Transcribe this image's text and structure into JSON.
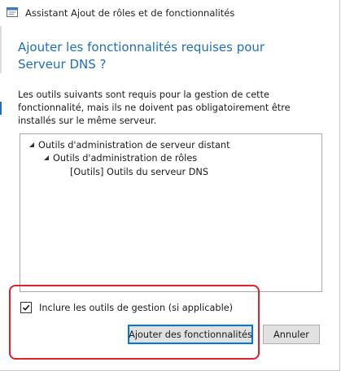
{
  "window": {
    "title": "Assistant Ajout de rôles et de fonctionnalités"
  },
  "dialog": {
    "heading": "Ajouter les fonctionnalités requises pour Serveur DNS ?",
    "description": "Les outils suivants sont requis pour la gestion de cette fonctionnalité, mais ils ne doivent pas obligatoirement être installés sur le même serveur."
  },
  "tree": {
    "items": [
      {
        "label": "Outils d'administration de serveur distant",
        "expanded": true
      },
      {
        "label": "Outils d'administration de rôles",
        "expanded": true
      },
      {
        "label": "[Outils] Outils du serveur DNS",
        "expanded": false
      }
    ]
  },
  "options": {
    "include_tools_label": "Inclure les outils de gestion (si applicable)",
    "include_tools_checked": true
  },
  "buttons": {
    "add_label": "Ajouter des fonctionnalités",
    "cancel_label": "Annuler"
  },
  "colors": {
    "heading": "#1c6fb8",
    "highlight": "#e0202a",
    "primary_border": "#0078d7"
  },
  "icons": {
    "app": "wizard-app-icon",
    "expand": "triangle-expanded-icon",
    "check": "checkmark-icon"
  }
}
